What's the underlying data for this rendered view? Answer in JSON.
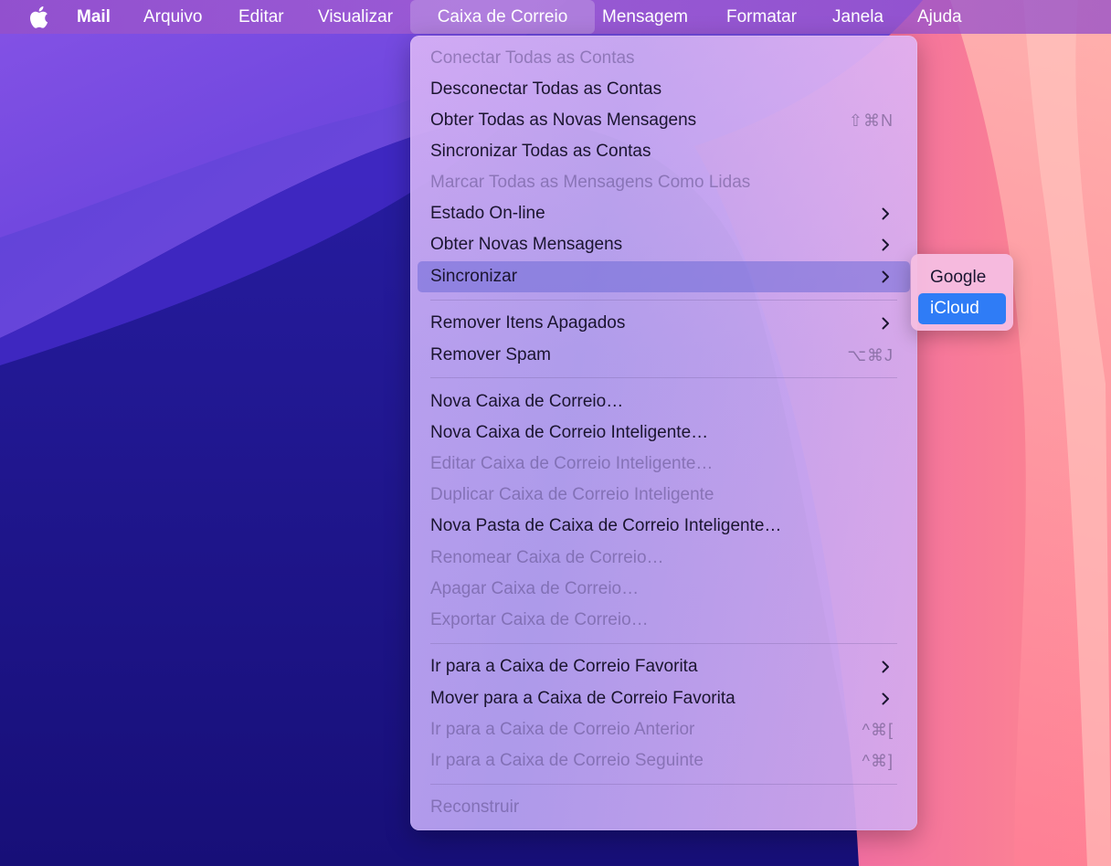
{
  "menubar": {
    "app_name": "Mail",
    "items": [
      "Arquivo",
      "Editar",
      "Visualizar",
      "Caixa de Correio",
      "Mensagem",
      "Formatar",
      "Janela",
      "Ajuda"
    ]
  },
  "menu": {
    "items": [
      {
        "label": "Conectar Todas as Contas",
        "enabled": false,
        "shortcut": "",
        "submenu": false
      },
      {
        "label": "Desconectar Todas as Contas",
        "enabled": true,
        "shortcut": "",
        "submenu": false
      },
      {
        "label": "Obter Todas as Novas Mensagens",
        "enabled": true,
        "shortcut": "⇧⌘N",
        "submenu": false
      },
      {
        "label": "Sincronizar Todas as Contas",
        "enabled": true,
        "shortcut": "",
        "submenu": false
      },
      {
        "label": "Marcar Todas as Mensagens Como Lidas",
        "enabled": false,
        "shortcut": "",
        "submenu": false
      },
      {
        "label": "Estado On-line",
        "enabled": true,
        "shortcut": "",
        "submenu": true
      },
      {
        "label": "Obter Novas Mensagens",
        "enabled": true,
        "shortcut": "",
        "submenu": true
      },
      {
        "label": "Sincronizar",
        "enabled": true,
        "shortcut": "",
        "submenu": true,
        "highlighted": true
      },
      {
        "label": "Remover Itens Apagados",
        "enabled": true,
        "shortcut": "",
        "submenu": true
      },
      {
        "label": "Remover Spam",
        "enabled": true,
        "shortcut": "⌥⌘J",
        "submenu": false
      },
      {
        "label": "Nova Caixa de Correio…",
        "enabled": true,
        "shortcut": "",
        "submenu": false
      },
      {
        "label": "Nova Caixa de Correio Inteligente…",
        "enabled": true,
        "shortcut": "",
        "submenu": false
      },
      {
        "label": "Editar Caixa de Correio Inteligente…",
        "enabled": false,
        "shortcut": "",
        "submenu": false
      },
      {
        "label": "Duplicar Caixa de Correio Inteligente",
        "enabled": false,
        "shortcut": "",
        "submenu": false
      },
      {
        "label": "Nova Pasta de Caixa de Correio Inteligente…",
        "enabled": true,
        "shortcut": "",
        "submenu": false
      },
      {
        "label": "Renomear Caixa de Correio…",
        "enabled": false,
        "shortcut": "",
        "submenu": false
      },
      {
        "label": "Apagar Caixa de Correio…",
        "enabled": false,
        "shortcut": "",
        "submenu": false
      },
      {
        "label": "Exportar Caixa de Correio…",
        "enabled": false,
        "shortcut": "",
        "submenu": false
      },
      {
        "label": "Ir para a Caixa de Correio Favorita",
        "enabled": true,
        "shortcut": "",
        "submenu": true
      },
      {
        "label": "Mover para a Caixa de Correio Favorita",
        "enabled": true,
        "shortcut": "",
        "submenu": true
      },
      {
        "label": "Ir para a Caixa de Correio Anterior",
        "enabled": false,
        "shortcut": "^⌘[",
        "submenu": false
      },
      {
        "label": "Ir para a Caixa de Correio Seguinte",
        "enabled": false,
        "shortcut": "^⌘]",
        "submenu": false
      },
      {
        "label": "Reconstruir",
        "enabled": false,
        "shortcut": "",
        "submenu": false
      }
    ]
  },
  "submenu": {
    "items": [
      {
        "label": "Google",
        "selected": false
      },
      {
        "label": "iCloud",
        "selected": true
      }
    ]
  },
  "colors": {
    "selection_blue": "#2f7cf6",
    "menu_highlight": "#7a72d8"
  }
}
